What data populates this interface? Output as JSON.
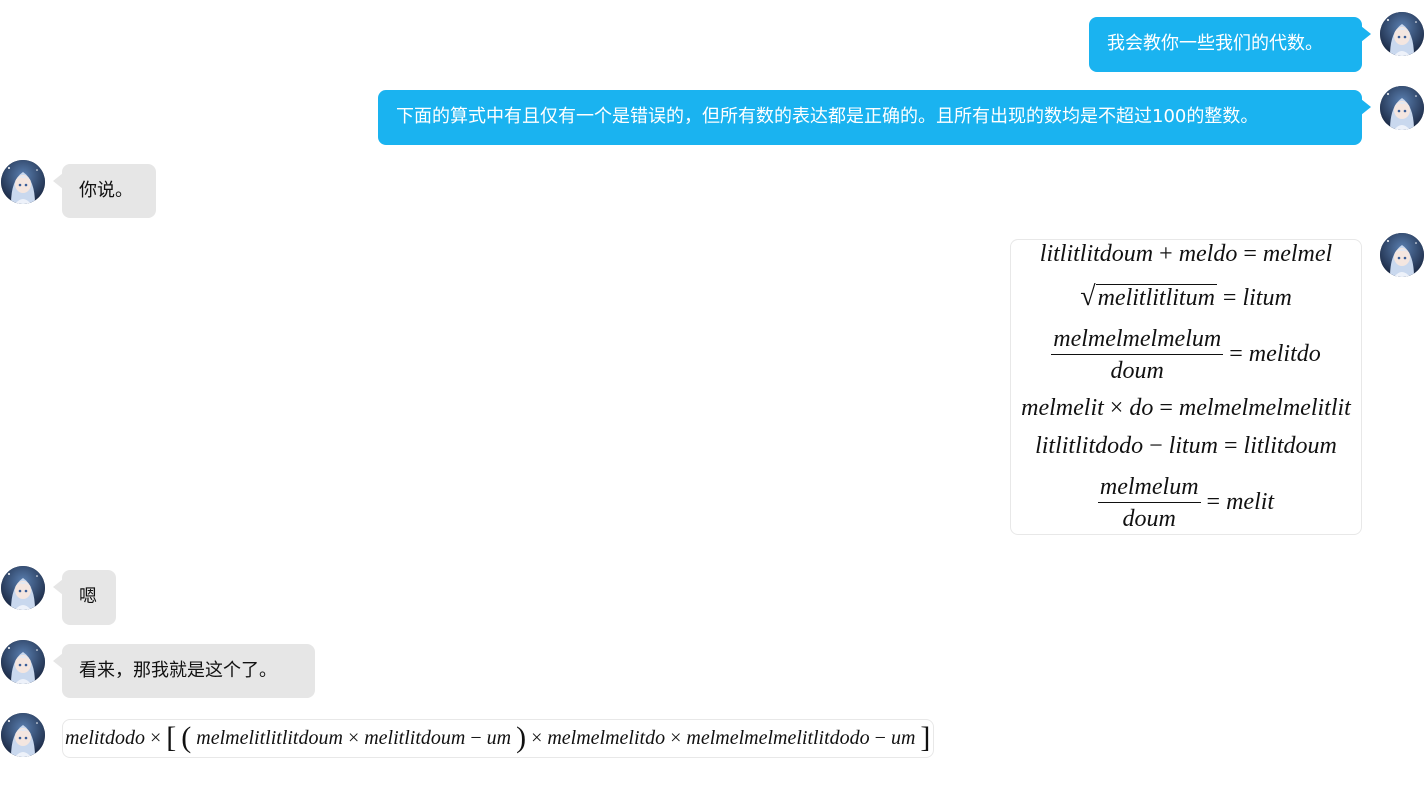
{
  "messages": [
    {
      "side": "right",
      "text": "我会教你一些我们的代数。"
    },
    {
      "side": "right",
      "text": "下面的算式中有且仅有一个是错误的，但所有数的表达都是正确的。且所有出现的数均是不超过100的整数。"
    },
    {
      "side": "left",
      "text": "你说。"
    },
    {
      "side": "right",
      "type": "math",
      "equations": {
        "e1": {
          "a": "litlitlitdoum",
          "op": "+",
          "b": "meldo",
          "eq": "=",
          "r": "melmel"
        },
        "e2": {
          "a": "melitlitlitum",
          "eq": "=",
          "r": "litum"
        },
        "e3": {
          "num": "melmelmelmelum",
          "den": "doum",
          "eq": "=",
          "r": "melitdo"
        },
        "e4": {
          "a": "melmelit",
          "op": "×",
          "b": "do",
          "eq": "=",
          "r": "melmelmelmelitlit"
        },
        "e5": {
          "a": "litlitlitdodo",
          "op": "−",
          "b": "litum",
          "eq": "=",
          "r": "litlitdoum"
        },
        "e6": {
          "num": "melmelum",
          "den": "doum",
          "eq": "=",
          "r": "melit"
        }
      }
    },
    {
      "side": "left",
      "text": "嗯"
    },
    {
      "side": "left",
      "text": "看来，那我就是这个了。"
    },
    {
      "side": "left",
      "type": "math",
      "expression": {
        "t1": "melitdodo",
        "x1": "×",
        "lb": "[",
        "lp": "(",
        "t2": "melmelitlitlitdoum",
        "x2": "×",
        "t3": "melitlitdoum",
        "m1": "−",
        "t4": "um",
        "rp": ")",
        "x3": "×",
        "t5": "melmelmelitdo",
        "x4": "×",
        "t6": "melmelmelmelitlitdodo",
        "m2": "−",
        "t7": "um",
        "rb": "]"
      }
    }
  ],
  "avatars": {
    "icon": "anime-girl-avatar-icon",
    "bg": "#22304a",
    "hair": "#c9d8ee"
  },
  "colors": {
    "bubble_right": "#1ab3f0",
    "bubble_left": "#e6e6e6",
    "background": "#ffffff"
  }
}
